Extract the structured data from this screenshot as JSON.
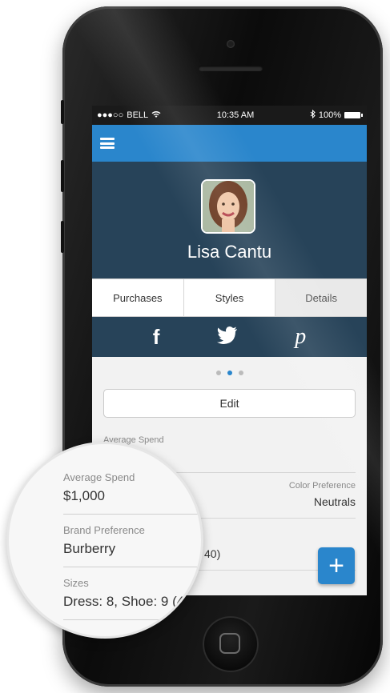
{
  "status_bar": {
    "signal": "●●●○○",
    "carrier": "BELL",
    "wifi_icon": "wifi",
    "time": "10:35 AM",
    "bluetooth_icon": "bluetooth",
    "battery": "100%"
  },
  "profile": {
    "name": "Lisa Cantu"
  },
  "tabs": [
    {
      "label": "Purchases"
    },
    {
      "label": "Styles"
    },
    {
      "label": "Details"
    }
  ],
  "social": {
    "facebook": "f",
    "twitter_icon": "twitter-bird",
    "pinterest": "p"
  },
  "page_indicator": {
    "count": 3,
    "active": 2
  },
  "edit_button": "Edit",
  "details": {
    "average_spend_label": "Average Spend",
    "average_spend_value": "$1,000",
    "color_preference_label": "Color Preference",
    "color_preference_value": "Neutrals",
    "brand_preference_label": "Brand Preference",
    "brand_preference_value": "Burberry",
    "sizes_label": "Sizes",
    "sizes_value": "Dress: 8, Shoe: 9 (40)",
    "sizes_partial": "40)"
  },
  "magnified": {
    "average_spend_label": "Average Spend",
    "average_spend_value": "$1,000",
    "brand_preference_label": "Brand Preference",
    "brand_preference_value": "Burberry",
    "sizes_label": "Sizes",
    "sizes_value": "Dress: 8, Shoe: 9 (4"
  },
  "fab_label": "+",
  "colors": {
    "accent": "#2a86cc",
    "header_dark": "#274359",
    "background": "#f2f2f2"
  }
}
